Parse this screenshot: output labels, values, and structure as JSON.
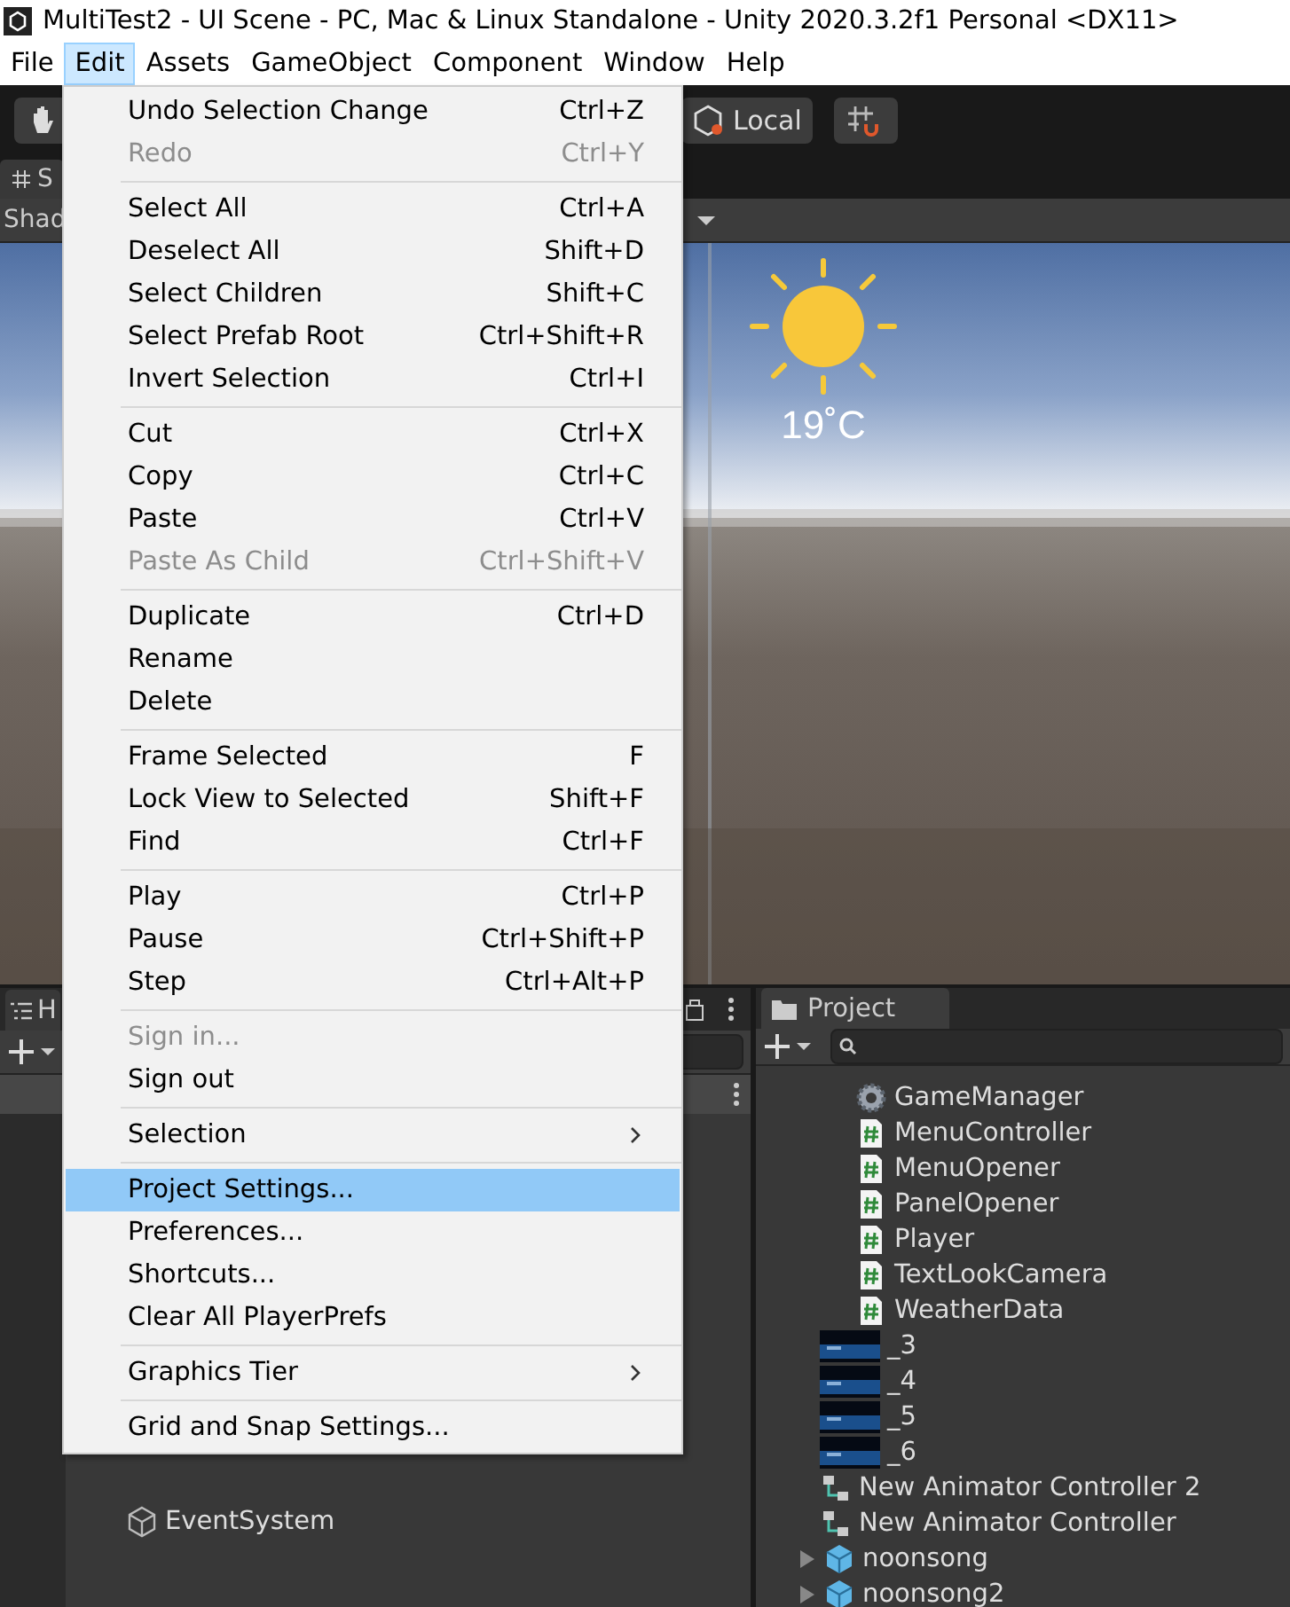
{
  "window": {
    "title": "MultiTest2 - UI Scene - PC, Mac & Linux Standalone - Unity 2020.3.2f1 Personal <DX11>"
  },
  "menu_bar": [
    {
      "label": "File",
      "selected": false
    },
    {
      "label": "Edit",
      "selected": true
    },
    {
      "label": "Assets",
      "selected": false
    },
    {
      "label": "GameObject",
      "selected": false
    },
    {
      "label": "Component",
      "selected": false
    },
    {
      "label": "Window",
      "selected": false
    },
    {
      "label": "Help",
      "selected": false
    }
  ],
  "toolbar": {
    "pivot_button": "Local"
  },
  "scene": {
    "tab": "S",
    "shading_label": "Shad",
    "temperature": "19˚C"
  },
  "edit_menu": [
    [
      {
        "label": "Undo Selection Change",
        "shortcut": "Ctrl+Z",
        "disabled": false,
        "highlighted": false,
        "submenu": false
      },
      {
        "label": "Redo",
        "shortcut": "Ctrl+Y",
        "disabled": true,
        "highlighted": false,
        "submenu": false
      }
    ],
    [
      {
        "label": "Select All",
        "shortcut": "Ctrl+A",
        "disabled": false,
        "highlighted": false,
        "submenu": false
      },
      {
        "label": "Deselect All",
        "shortcut": "Shift+D",
        "disabled": false,
        "highlighted": false,
        "submenu": false
      },
      {
        "label": "Select Children",
        "shortcut": "Shift+C",
        "disabled": false,
        "highlighted": false,
        "submenu": false
      },
      {
        "label": "Select Prefab Root",
        "shortcut": "Ctrl+Shift+R",
        "disabled": false,
        "highlighted": false,
        "submenu": false
      },
      {
        "label": "Invert Selection",
        "shortcut": "Ctrl+I",
        "disabled": false,
        "highlighted": false,
        "submenu": false
      }
    ],
    [
      {
        "label": "Cut",
        "shortcut": "Ctrl+X",
        "disabled": false,
        "highlighted": false,
        "submenu": false
      },
      {
        "label": "Copy",
        "shortcut": "Ctrl+C",
        "disabled": false,
        "highlighted": false,
        "submenu": false
      },
      {
        "label": "Paste",
        "shortcut": "Ctrl+V",
        "disabled": false,
        "highlighted": false,
        "submenu": false
      },
      {
        "label": "Paste As Child",
        "shortcut": "Ctrl+Shift+V",
        "disabled": true,
        "highlighted": false,
        "submenu": false
      }
    ],
    [
      {
        "label": "Duplicate",
        "shortcut": "Ctrl+D",
        "disabled": false,
        "highlighted": false,
        "submenu": false
      },
      {
        "label": "Rename",
        "disabled": false,
        "highlighted": false,
        "submenu": false
      },
      {
        "label": "Delete",
        "disabled": false,
        "highlighted": false,
        "submenu": false
      }
    ],
    [
      {
        "label": "Frame Selected",
        "shortcut": "F",
        "disabled": false,
        "highlighted": false,
        "submenu": false
      },
      {
        "label": "Lock View to Selected",
        "shortcut": "Shift+F",
        "disabled": false,
        "highlighted": false,
        "submenu": false
      },
      {
        "label": "Find",
        "shortcut": "Ctrl+F",
        "disabled": false,
        "highlighted": false,
        "submenu": false
      }
    ],
    [
      {
        "label": "Play",
        "shortcut": "Ctrl+P",
        "disabled": false,
        "highlighted": false,
        "submenu": false
      },
      {
        "label": "Pause",
        "shortcut": "Ctrl+Shift+P",
        "disabled": false,
        "highlighted": false,
        "submenu": false
      },
      {
        "label": "Step",
        "shortcut": "Ctrl+Alt+P",
        "disabled": false,
        "highlighted": false,
        "submenu": false
      }
    ],
    [
      {
        "label": "Sign in...",
        "disabled": true,
        "highlighted": false,
        "submenu": false
      },
      {
        "label": "Sign out",
        "disabled": false,
        "highlighted": false,
        "submenu": false
      }
    ],
    [
      {
        "label": "Selection",
        "disabled": false,
        "highlighted": false,
        "submenu": true
      }
    ],
    [
      {
        "label": "Project Settings...",
        "disabled": false,
        "highlighted": true,
        "submenu": false
      },
      {
        "label": "Preferences...",
        "disabled": false,
        "highlighted": false,
        "submenu": false
      },
      {
        "label": "Shortcuts...",
        "disabled": false,
        "highlighted": false,
        "submenu": false
      },
      {
        "label": "Clear All PlayerPrefs",
        "disabled": false,
        "highlighted": false,
        "submenu": false
      }
    ],
    [
      {
        "label": "Graphics Tier",
        "disabled": false,
        "highlighted": false,
        "submenu": true
      }
    ],
    [
      {
        "label": "Grid and Snap Settings...",
        "disabled": false,
        "highlighted": false,
        "submenu": false
      }
    ]
  ],
  "hierarchy": {
    "tab": "H",
    "items": [
      "EventSystem"
    ]
  },
  "project": {
    "tab": "Project",
    "items": [
      {
        "name": "GameManager",
        "kind": "gear"
      },
      {
        "name": "MenuController",
        "kind": "script"
      },
      {
        "name": "MenuOpener",
        "kind": "script"
      },
      {
        "name": "PanelOpener",
        "kind": "script"
      },
      {
        "name": "Player",
        "kind": "script"
      },
      {
        "name": "TextLookCamera",
        "kind": "script"
      },
      {
        "name": "WeatherData",
        "kind": "script"
      },
      {
        "name": "_3",
        "kind": "texture"
      },
      {
        "name": "_4",
        "kind": "texture"
      },
      {
        "name": "_5",
        "kind": "texture"
      },
      {
        "name": "_6",
        "kind": "texture"
      },
      {
        "name": "New Animator Controller 2",
        "kind": "animator"
      },
      {
        "name": "New Animator Controller",
        "kind": "animator"
      },
      {
        "name": "noonsong",
        "kind": "prefab",
        "expanded": false
      },
      {
        "name": "noonsong2",
        "kind": "prefab",
        "expanded": false
      }
    ]
  }
}
